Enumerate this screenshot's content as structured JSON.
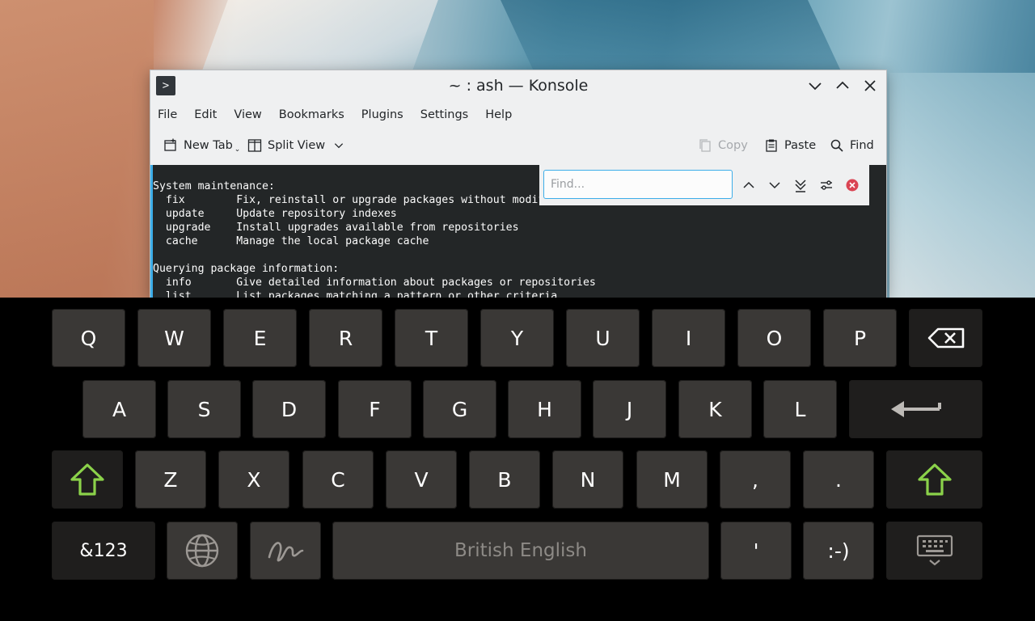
{
  "window": {
    "title": "~ : ash — Konsole",
    "menu": [
      "File",
      "Edit",
      "View",
      "Bookmarks",
      "Plugins",
      "Settings",
      "Help"
    ],
    "toolbar": {
      "new_tab": "New Tab",
      "split_view": "Split View",
      "copy": "Copy",
      "paste": "Paste",
      "find": "Find"
    },
    "findbar": {
      "placeholder": "Find..."
    },
    "terminal_lines": [
      "System maintenance:",
      "  fix        Fix, reinstall or upgrade packages without modifying",
      "  update     Update repository indexes",
      "  upgrade    Install upgrades available from repositories",
      "  cache      Manage the local package cache",
      "",
      "Querying package information:",
      "  info       Give detailed information about packages or repositories",
      "  list       List packages matching a pattern or other criteria"
    ]
  },
  "keyboard": {
    "row1": [
      "Q",
      "W",
      "E",
      "R",
      "T",
      "Y",
      "U",
      "I",
      "O",
      "P"
    ],
    "row2": [
      "A",
      "S",
      "D",
      "F",
      "G",
      "H",
      "J",
      "K",
      "L"
    ],
    "row3": [
      "Z",
      "X",
      "C",
      "V",
      "B",
      "N",
      "M",
      ",",
      "."
    ],
    "row4": {
      "symbols": "&123",
      "space": "British English",
      "apostrophe": "'",
      "smiley": ":-)"
    },
    "accent_color": "#8bd24a",
    "icons": [
      "backspace-icon",
      "enter-icon",
      "shift-icon",
      "globe-icon",
      "swipe-icon",
      "hide-keyboard-icon"
    ]
  }
}
